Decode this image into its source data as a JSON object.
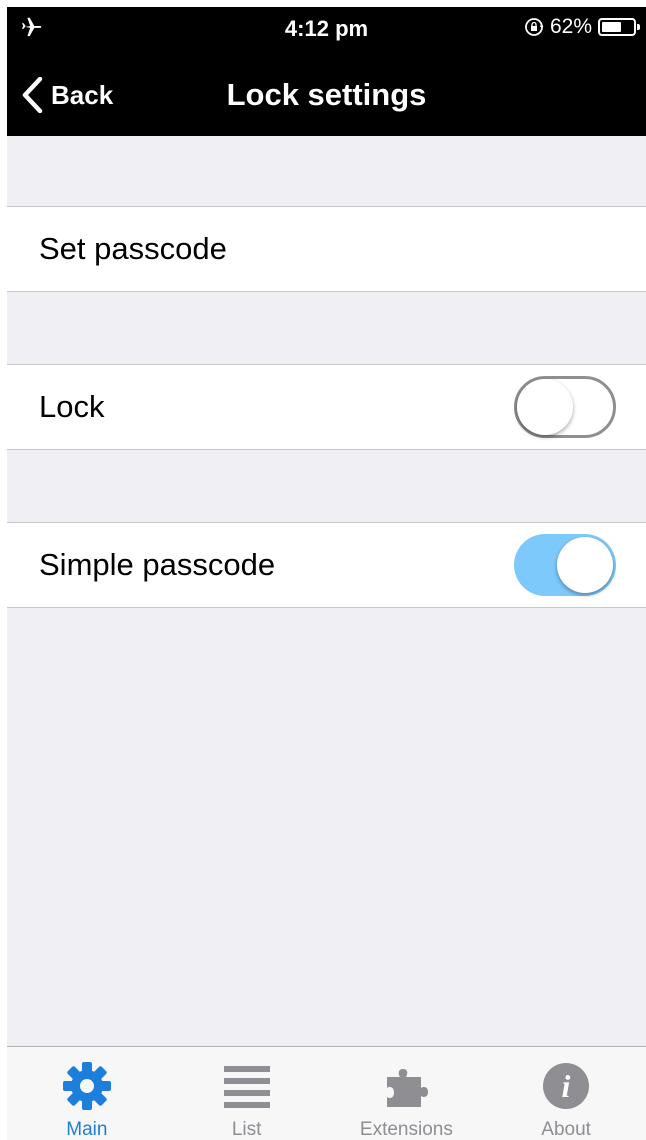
{
  "status_bar": {
    "time": "4:12 pm",
    "battery_percent": "62%",
    "battery_level": 0.62,
    "icons": [
      "airplane-icon",
      "rotation-lock-icon",
      "battery-icon"
    ]
  },
  "nav": {
    "back_label": "Back",
    "title": "Lock settings"
  },
  "rows": {
    "set_passcode": {
      "label": "Set passcode"
    },
    "lock": {
      "label": "Lock",
      "toggle_on": false
    },
    "simple_passcode": {
      "label": "Simple passcode",
      "toggle_on": true
    }
  },
  "tabs": [
    {
      "label": "Main",
      "icon": "gear-icon",
      "active": true
    },
    {
      "label": "List",
      "icon": "list-icon",
      "active": false
    },
    {
      "label": "Extensions",
      "icon": "puzzle-icon",
      "active": false
    },
    {
      "label": "About",
      "icon": "info-icon",
      "active": false
    }
  ],
  "colors": {
    "header_bg": "#000000",
    "background": "#efeff4",
    "toggle_on": "#7ec9fb",
    "active_tab": "#1d7edb",
    "inactive_tab": "#8e8e93"
  }
}
